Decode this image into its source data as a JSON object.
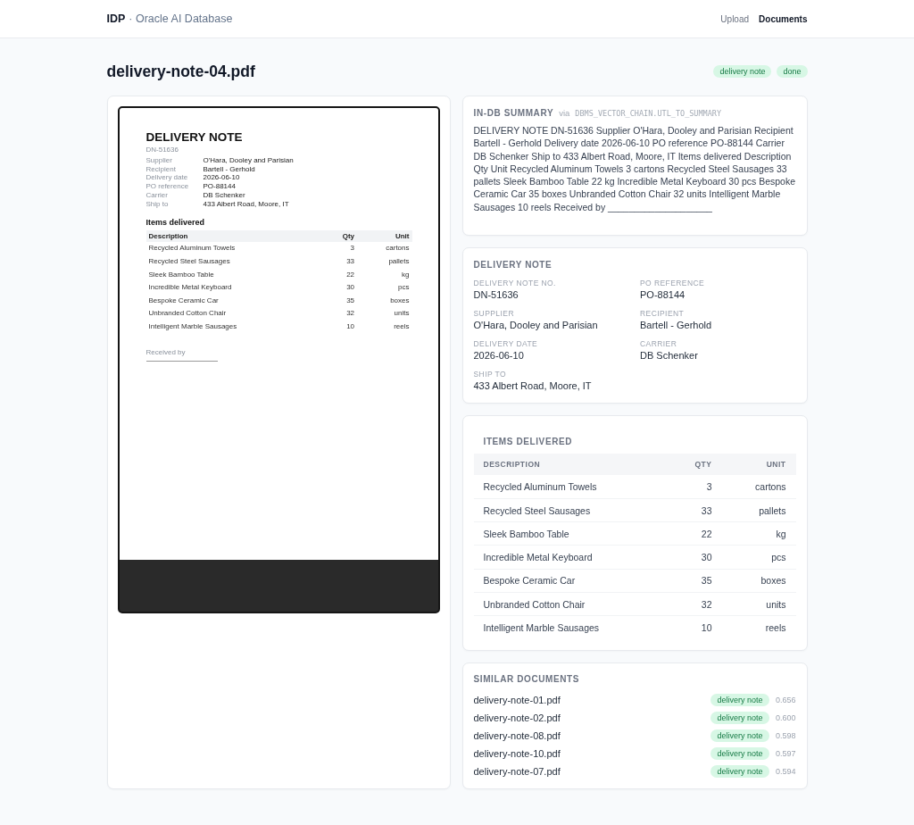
{
  "header": {
    "brand": "IDP",
    "subtitle": "· Oracle AI Database",
    "nav": [
      {
        "label": "Upload",
        "selected": false
      },
      {
        "label": "Documents",
        "selected": true
      }
    ]
  },
  "document": {
    "title": "delivery-note-04.pdf",
    "badges": [
      "delivery note",
      "done"
    ]
  },
  "preview": {
    "heading": "DELIVERY NOTE",
    "number": "DN-51636",
    "fields": [
      {
        "label": "Supplier",
        "value": "O'Hara, Dooley and Parisian"
      },
      {
        "label": "Recipient",
        "value": "Bartell - Gerhold"
      },
      {
        "label": "Delivery date",
        "value": "2026-06-10"
      },
      {
        "label": "PO reference",
        "value": "PO-88144"
      },
      {
        "label": "Carrier",
        "value": "DB Schenker"
      },
      {
        "label": "Ship to",
        "value": "433 Albert Road, Moore, IT"
      }
    ],
    "items_title": "Items delivered",
    "columns": [
      "Description",
      "Qty",
      "Unit"
    ],
    "rows": [
      [
        "Recycled Aluminum Towels",
        "3",
        "cartons"
      ],
      [
        "Recycled Steel Sausages",
        "33",
        "pallets"
      ],
      [
        "Sleek Bamboo Table",
        "22",
        "kg"
      ],
      [
        "Incredible Metal Keyboard",
        "30",
        "pcs"
      ],
      [
        "Bespoke Ceramic Car",
        "35",
        "boxes"
      ],
      [
        "Unbranded Cotton Chair",
        "32",
        "units"
      ],
      [
        "Intelligent Marble Sausages",
        "10",
        "reels"
      ]
    ],
    "signature_label": "Received by"
  },
  "summary": {
    "title": "IN-DB SUMMARY",
    "via": "via",
    "source": "DBMS_VECTOR_CHAIN.UTL_TO_SUMMARY",
    "text": "DELIVERY NOTE DN-51636 Supplier O'Hara, Dooley and Parisian Recipient Bartell - Gerhold Delivery date 2026-06-10 PO reference PO-88144 Carrier DB Schenker Ship to 433 Albert Road, Moore, IT Items delivered Description Qty Unit Recycled Aluminum Towels 3 cartons Recycled Steel Sausages 33 pallets Sleek Bamboo Table 22 kg Incredible Metal Keyboard 30 pcs Bespoke Ceramic Car 35 boxes Unbranded Cotton Chair 32 units Intelligent Marble Sausages 10 reels Received by ____________________"
  },
  "extracted": {
    "title": "DELIVERY NOTE",
    "fields": [
      {
        "label": "DELIVERY NOTE NO.",
        "value": "DN-51636"
      },
      {
        "label": "PO REFERENCE",
        "value": "PO-88144"
      },
      {
        "label": "SUPPLIER",
        "value": "O'Hara, Dooley and Parisian"
      },
      {
        "label": "RECIPIENT",
        "value": "Bartell - Gerhold"
      },
      {
        "label": "DELIVERY DATE",
        "value": "2026-06-10"
      },
      {
        "label": "CARRIER",
        "value": "DB Schenker"
      },
      {
        "label": "SHIP TO",
        "value": "433 Albert Road, Moore, IT"
      }
    ]
  },
  "items": {
    "title": "ITEMS DELIVERED",
    "columns": [
      "DESCRIPTION",
      "QTY",
      "UNIT"
    ],
    "rows": [
      [
        "Recycled Aluminum Towels",
        "3",
        "cartons"
      ],
      [
        "Recycled Steel Sausages",
        "33",
        "pallets"
      ],
      [
        "Sleek Bamboo Table",
        "22",
        "kg"
      ],
      [
        "Incredible Metal Keyboard",
        "30",
        "pcs"
      ],
      [
        "Bespoke Ceramic Car",
        "35",
        "boxes"
      ],
      [
        "Unbranded Cotton Chair",
        "32",
        "units"
      ],
      [
        "Intelligent Marble Sausages",
        "10",
        "reels"
      ]
    ]
  },
  "similar": {
    "title": "SIMILAR DOCUMENTS",
    "documents": [
      {
        "name": "delivery-note-01.pdf",
        "type": "delivery note",
        "score": "0.656"
      },
      {
        "name": "delivery-note-02.pdf",
        "type": "delivery note",
        "score": "0.600"
      },
      {
        "name": "delivery-note-08.pdf",
        "type": "delivery note",
        "score": "0.598"
      },
      {
        "name": "delivery-note-10.pdf",
        "type": "delivery note",
        "score": "0.597"
      },
      {
        "name": "delivery-note-07.pdf",
        "type": "delivery note",
        "score": "0.594"
      }
    ]
  }
}
